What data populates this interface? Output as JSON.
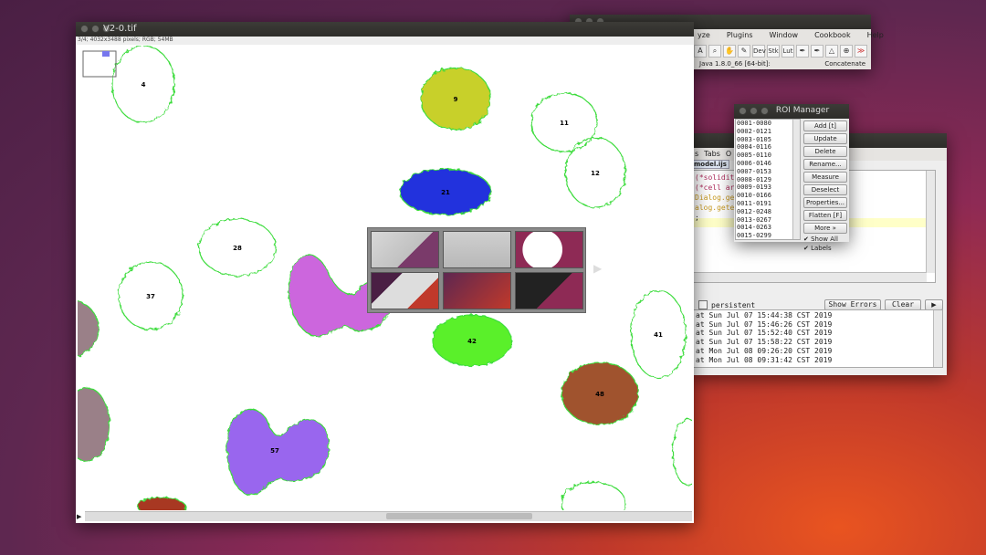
{
  "imagej": {
    "menu": [
      "yze",
      "Plugins",
      "Window",
      "Cookbook",
      "Help"
    ],
    "status": "Java 1.8.0_66 [64-bit]:",
    "concatenate": "Concatenate",
    "tools": [
      "A",
      "⌕",
      "✋",
      "✎",
      "Dev",
      "Stk",
      "Lut",
      "✒",
      "✒",
      "△",
      "⊕",
      "≫"
    ]
  },
  "image_window": {
    "title": "V2-0.tif",
    "info": "3/4; 4032x3488 pixels; RGB; 54MB"
  },
  "roi_manager": {
    "title": "ROI Manager",
    "items": [
      "0001-0080",
      "0002-0121",
      "0003-0105",
      "0004-0116",
      "0005-0110",
      "0006-0146",
      "0007-0153",
      "0008-0129",
      "0009-0193",
      "0010-0166",
      "0011-0191",
      "0012-0248",
      "0013-0267",
      "0014-0263",
      "0015-0299"
    ],
    "buttons": [
      "Add [t]",
      "Update",
      "Delete",
      "Rename...",
      "Measure",
      "Deselect",
      "Properties...",
      "Flatten [F]",
      "More »"
    ],
    "checkboxes": [
      {
        "label": "Show All",
        "checked": true
      },
      {
        "label": "Labels",
        "checked": true
      }
    ]
  },
  "editor": {
    "menu": [
      "s",
      "Tabs",
      "O"
    ],
    "tab": "model.ijs",
    "code_lines": [
      "(*solidit",
      "(*cell ar",
      "",
      "Dialog.ge",
      "alog.gete",
      "",
      ";"
    ],
    "persistent_label": "persistent",
    "show_errors": "Show Errors",
    "clear": "Clear",
    "run": "▶",
    "log": [
      "at Sun Jul 07 15:44:38 CST 2019",
      "at Sun Jul 07 15:46:26 CST 2019",
      "at Sun Jul 07 15:52:40 CST 2019",
      "at Sun Jul 07 15:58:22 CST 2019",
      "at Mon Jul 08 09:26:20 CST 2019",
      "at Mon Jul 08 09:31:42 CST 2019"
    ]
  },
  "cells": [
    {
      "label": "4",
      "fill": "none"
    },
    {
      "label": "9",
      "fill": "#c8d02a"
    },
    {
      "label": "11",
      "fill": "none"
    },
    {
      "label": "12",
      "fill": "none"
    },
    {
      "label": "21",
      "fill": "#2233dd"
    },
    {
      "label": "28",
      "fill": "none"
    },
    {
      "label": "37",
      "fill": "none"
    },
    {
      "label": "42",
      "fill": "#5af02a"
    },
    {
      "label": "41",
      "fill": "none"
    },
    {
      "label": "48",
      "fill": "#a0522d"
    },
    {
      "label": "57",
      "fill": "#9966ee"
    },
    {
      "label": "",
      "fill": "#cc66dd"
    }
  ],
  "colors": {
    "roi_outline": "#3ddc3d",
    "titlebar": "#3c3b37",
    "desktop_accent": "#e95420"
  }
}
